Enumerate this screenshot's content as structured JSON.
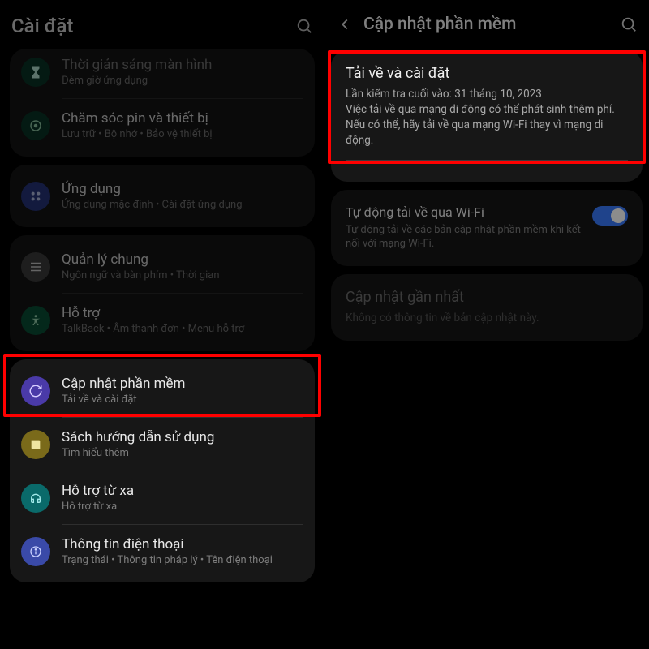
{
  "left": {
    "title": "Cài đặt",
    "items": {
      "screen_time": {
        "title": "Thời giản sáng màn hình",
        "sub": "Đèm giờ ứng dụng"
      },
      "battery": {
        "title": "Chăm sóc pin và thiết bị",
        "sub": "Lưu trữ  •  Bộ nhớ  •  Bảo vệ thiết bị"
      },
      "apps": {
        "title": "Ứng dụng",
        "sub": "Ứng dụng mặc định  •  Cài đặt ứng dụng"
      },
      "general": {
        "title": "Quản lý chung",
        "sub": "Ngôn ngữ và bàn phím  •  Thời gian"
      },
      "support": {
        "title": "Hỗ trợ",
        "sub": "TalkBack  •  Âm thanh đơn  •  Menu hỗ trợ"
      },
      "update": {
        "title": "Cập nhật phần mềm",
        "sub": "Tải về và cài đặt"
      },
      "manual": {
        "title": "Sách hướng dẫn sử dụng",
        "sub": "Tìm hiểu thêm"
      },
      "remote": {
        "title": "Hỗ trợ từ xa",
        "sub": "Hỗ trợ từ xa"
      },
      "about": {
        "title": "Thông tin điện thoại",
        "sub": "Trạng thái  •  Thông tin pháp lý  •  Tên điện thoại"
      }
    }
  },
  "right": {
    "title": "Cập nhật phần mềm",
    "download": {
      "title": "Tải về và cài đặt",
      "desc1": "Lần kiểm tra cuối vào: 31 tháng 10, 2023",
      "desc2": "Việc tải về qua mạng di động có thể phát sinh thêm phí. Nếu có thể, hãy tải về qua mạng Wi-Fi thay vì mạng di động."
    },
    "autowifi": {
      "title": "Tự động tải về qua Wi-Fi",
      "desc": "Tự động tải về các bản cập nhật phần mềm khi kết nối với mạng Wi-Fi."
    },
    "last": {
      "title": "Cập nhật gần nhất",
      "desc": "Không có thông tin về bản cập nhật này."
    }
  },
  "colors": {
    "ic_screen": "#0a3a2a",
    "ic_battery": "#0a3a2a",
    "ic_apps": "#2a3a8a",
    "ic_general": "#444",
    "ic_support": "#0a5a3c",
    "ic_update": "#4a3aa8",
    "ic_manual": "#7a6a1a",
    "ic_remote": "#0a6a6a",
    "ic_about": "#3a4aa8"
  }
}
